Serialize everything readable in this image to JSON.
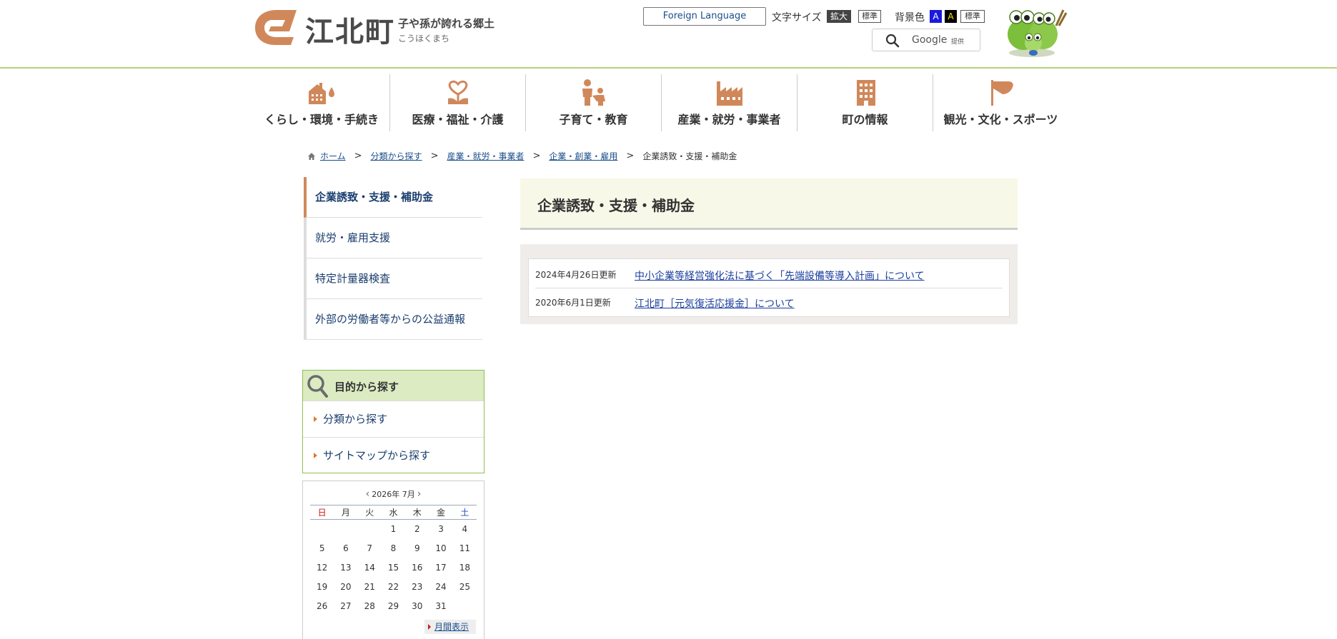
{
  "header": {
    "site_name": "江北町",
    "tagline": "子や孫が誇れる郷土",
    "reading": "こうほくまち",
    "foreign_language": "Foreign Language",
    "font_size_label": "文字サイズ",
    "font_size_large": "拡大",
    "font_size_standard": "標準",
    "bg_color_label": "背景色",
    "bg_blue": "A",
    "bg_black": "A",
    "bg_standard": "標準",
    "search_google": "Google",
    "search_provided": "提供"
  },
  "gnav": [
    {
      "label": "くらし・環境・手続き",
      "icon": "house-icon"
    },
    {
      "label": "医療・福祉・介護",
      "icon": "flower-icon"
    },
    {
      "label": "子育て・教育",
      "icon": "parent-child-icon"
    },
    {
      "label": "産業・就労・事業者",
      "icon": "factory-icon"
    },
    {
      "label": "町の情報",
      "icon": "building-icon"
    },
    {
      "label": "観光・文化・スポーツ",
      "icon": "flag-icon"
    }
  ],
  "breadcrumb": {
    "items": [
      "ホーム",
      "分類から探す",
      "産業・就労・事業者",
      "企業・創業・雇用"
    ],
    "current": "企業誘致・支援・補助金"
  },
  "sidemenu": [
    {
      "label": "企業誘致・支援・補助金"
    },
    {
      "label": "就労・雇用支援"
    },
    {
      "label": "特定計量器検査"
    },
    {
      "label": "外部の労働者等からの公益通報"
    }
  ],
  "purpose": {
    "title": "目的から探す",
    "items": [
      "分類から探す",
      "サイトマップから探す"
    ]
  },
  "calendar": {
    "title": "2026年 7月",
    "weekdays": [
      "日",
      "月",
      "火",
      "水",
      "木",
      "金",
      "土"
    ],
    "weeks": [
      [
        "",
        "",
        "",
        "1",
        "2",
        "3",
        "4"
      ],
      [
        "5",
        "6",
        "7",
        "8",
        "9",
        "10",
        "11"
      ],
      [
        "12",
        "13",
        "14",
        "15",
        "16",
        "17",
        "18"
      ],
      [
        "19",
        "20",
        "21",
        "22",
        "23",
        "24",
        "25"
      ],
      [
        "26",
        "27",
        "28",
        "29",
        "30",
        "31",
        ""
      ]
    ],
    "monthly_view": "月間表示"
  },
  "main": {
    "title": "企業誘致・支援・補助金",
    "entries": [
      {
        "date": "2024年4月26日更新",
        "title": "中小企業等経営強化法に基づく「先端設備等導入計画」について"
      },
      {
        "date": "2020年6月1日更新",
        "title": "江北町［元気復活応援金］について"
      }
    ]
  },
  "colors": {
    "accent": "#d0885a",
    "header_line": "#b9cf7a",
    "link": "#1a3e6e",
    "purpose_bg": "#dcebc2"
  }
}
